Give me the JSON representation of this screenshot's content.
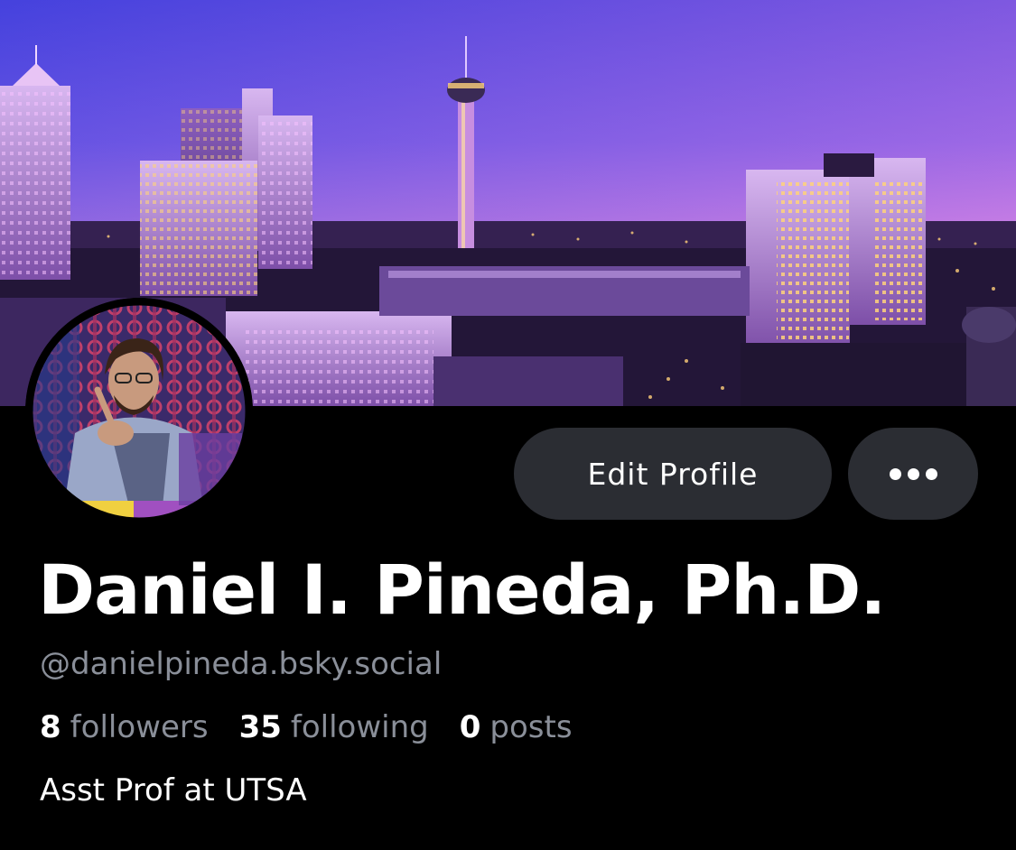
{
  "profile": {
    "display_name": "Daniel I. Pineda, Ph.D.",
    "handle": "@danielpineda.bsky.social",
    "bio": "Asst Prof at UTSA",
    "stats": {
      "followers_count": "8",
      "followers_label": "followers",
      "following_count": "35",
      "following_label": "following",
      "posts_count": "0",
      "posts_label": "posts"
    }
  },
  "actions": {
    "edit_label": "Edit Profile",
    "more_icon": "ellipsis-icon"
  },
  "colors": {
    "background": "#000000",
    "button_bg": "#2b2d33",
    "muted_text": "#8a8f99",
    "banner_sky_top": "#5b4fe0",
    "banner_sky_bottom": "#b57be8"
  }
}
